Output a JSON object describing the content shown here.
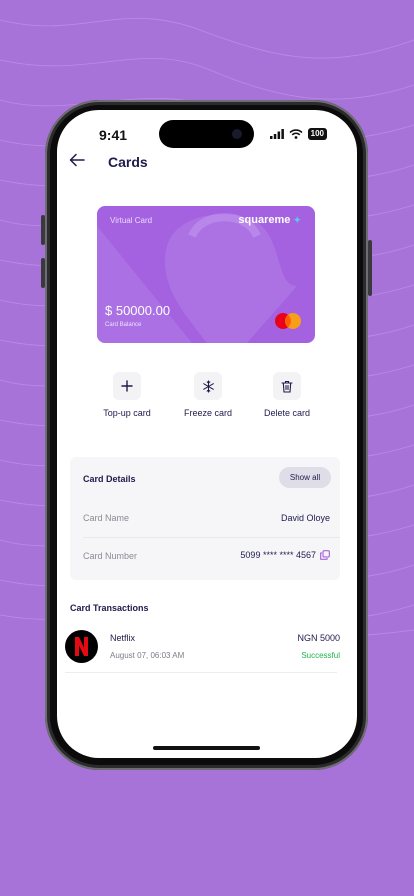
{
  "status_bar": {
    "time": "9:41",
    "battery": "100"
  },
  "header": {
    "title": "Cards",
    "back_icon": "arrow-left-icon"
  },
  "card": {
    "label": "Virtual Card",
    "brand": "squareme",
    "balance": "$ 50000.00",
    "balance_label": "Card Balance",
    "network_icon": "mastercard-logo",
    "color": "#a462e0"
  },
  "actions": [
    {
      "label": "Top-up card",
      "icon": "plus-icon"
    },
    {
      "label": "Freeze card",
      "icon": "snowflake-icon"
    },
    {
      "label": "Delete card",
      "icon": "trash-icon"
    }
  ],
  "card_details": {
    "title": "Card Details",
    "show_all": "Show all",
    "rows": [
      {
        "label": "Card Name",
        "value": "David Oloye"
      },
      {
        "label": "Card Number",
        "value": "5099 **** **** 4567",
        "icon": "copy-icon"
      }
    ]
  },
  "transactions": {
    "title": "Card Transactions",
    "items": [
      {
        "merchant": "Netflix",
        "date": "August 07, 06:03 AM",
        "amount": "NGN 5000",
        "status": "Successful",
        "logo": "netflix-logo"
      }
    ]
  },
  "colors": {
    "accent": "#a873d9",
    "text": "#1e1b4b",
    "success": "#22b14c"
  }
}
